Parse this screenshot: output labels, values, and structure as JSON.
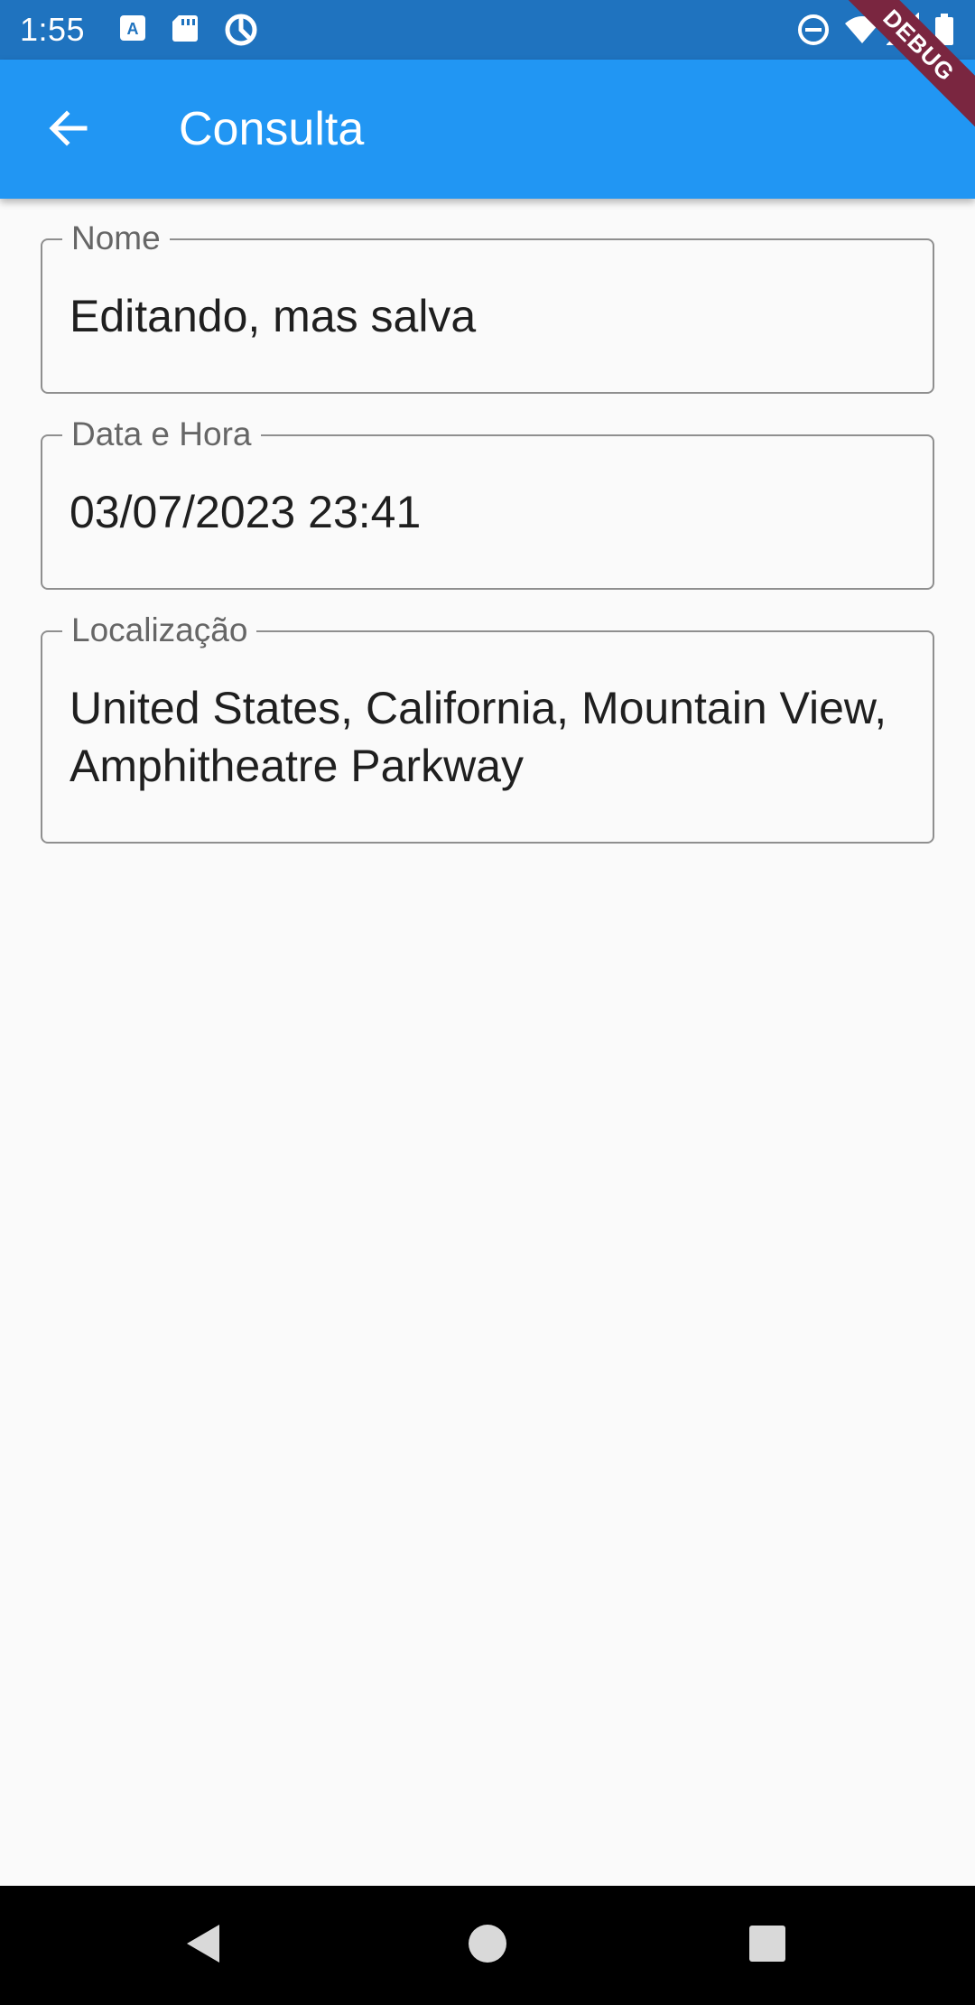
{
  "status_bar": {
    "time": "1:55",
    "left_icons": [
      "a-notification-icon",
      "sd-card-icon",
      "sync-icon"
    ],
    "right_icons": [
      "do-not-disturb-icon",
      "wifi-icon",
      "signal-icon",
      "battery-icon"
    ]
  },
  "debug_banner": {
    "label": "DEBUG"
  },
  "app_bar": {
    "title": "Consulta",
    "back_icon": "arrow-back-icon",
    "background": "#2196f3"
  },
  "form": {
    "fields": [
      {
        "label": "Nome",
        "value": "Editando, mas salva"
      },
      {
        "label": "Data e Hora",
        "value": "03/07/2023 23:41"
      },
      {
        "label": "Localização",
        "value": "United States, California, Mountain View, Amphitheatre Parkway"
      }
    ]
  },
  "nav_bar": {
    "buttons": [
      "back-triangle-icon",
      "home-circle-icon",
      "recents-square-icon"
    ]
  }
}
